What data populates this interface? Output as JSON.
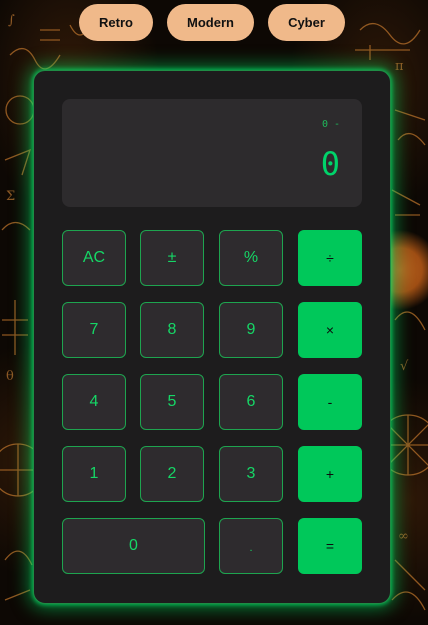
{
  "themes": [
    "Retro",
    "Modern",
    "Cyber"
  ],
  "display": {
    "expression": "0 -",
    "result": "0"
  },
  "keys": {
    "clear": "AC",
    "sign": "±",
    "percent": "%",
    "divide": "÷",
    "seven": "7",
    "eight": "8",
    "nine": "9",
    "multiply": "×",
    "four": "4",
    "five": "5",
    "six": "6",
    "subtract": "-",
    "one": "1",
    "two": "2",
    "three": "3",
    "add": "+",
    "zero": "0",
    "decimal": ".",
    "equals": "="
  },
  "colors": {
    "accent": "#00c85a",
    "display_text": "#00d36a",
    "theme_button": "#f0b98a",
    "panel": "#1d1c1d"
  }
}
